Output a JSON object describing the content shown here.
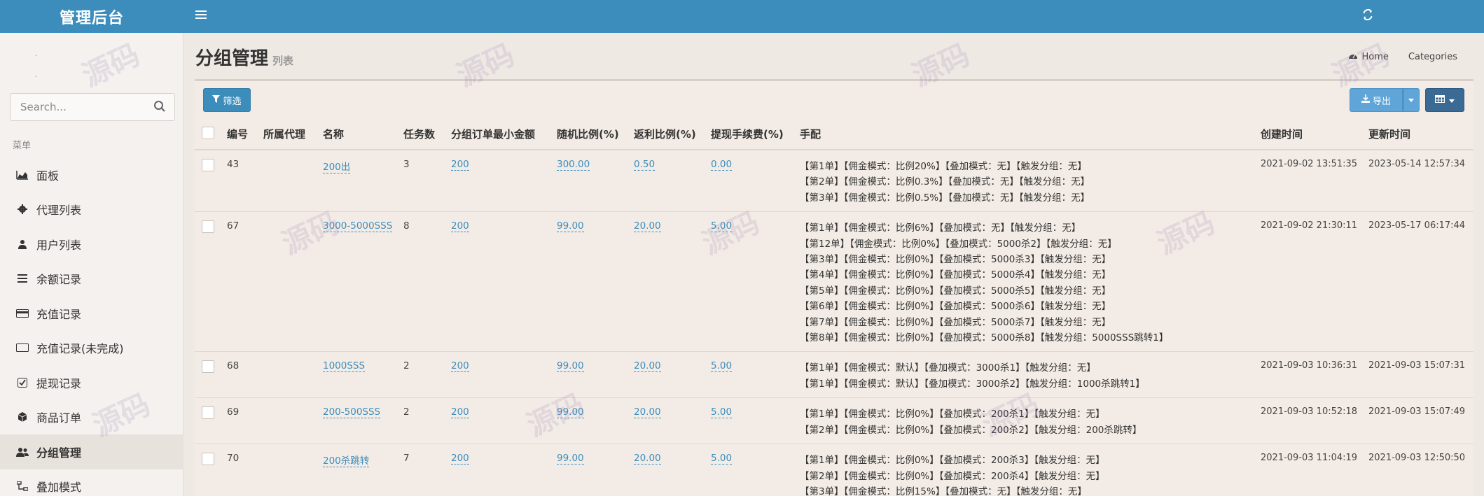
{
  "app": {
    "title": "管理后台"
  },
  "header": {
    "menu_icon": "hamburger-icon",
    "refresh_icon": "refresh-icon"
  },
  "sidebar": {
    "search_placeholder": "Search...",
    "menu_header": "菜单",
    "items": [
      {
        "label": "面板",
        "icon": "area-chart-icon"
      },
      {
        "label": "代理列表",
        "icon": "gear-icon"
      },
      {
        "label": "用户列表",
        "icon": "user-icon"
      },
      {
        "label": "余额记录",
        "icon": "list-icon"
      },
      {
        "label": "充值记录",
        "icon": "credit-card-icon"
      },
      {
        "label": "充值记录(未完成)",
        "icon": "credit-card-outline-icon"
      },
      {
        "label": "提现记录",
        "icon": "check-square-icon"
      },
      {
        "label": "商品订单",
        "icon": "cube-icon"
      },
      {
        "label": "分组管理",
        "icon": "users-icon"
      },
      {
        "label": "叠加模式",
        "icon": "sitemap-icon"
      }
    ]
  },
  "page": {
    "title": "分组管理",
    "subtitle": "列表"
  },
  "breadcrumb": {
    "home": "Home",
    "current": "Categories"
  },
  "toolbar": {
    "filter_label": "筛选",
    "export_label": "导出"
  },
  "table": {
    "headers": [
      "编号",
      "所属代理",
      "名称",
      "任务数",
      "分组订单最小金额",
      "随机比例(%)",
      "返利比例(%)",
      "提现手续费(%)",
      "手配",
      "创建时间",
      "更新时间"
    ],
    "rows": [
      {
        "id": "43",
        "agent": "",
        "name": "200出",
        "tasks": "3",
        "min_amount": "200",
        "random_ratio": "300.00",
        "rebate": "0.50",
        "fee": "0.00",
        "peipei": [
          "【第1单】【佣金模式：比例20%】【叠加模式：无】【触发分组：无】",
          "【第2单】【佣金模式：比例0.3%】【叠加模式：无】【触发分组：无】",
          "【第3单】【佣金模式：比例0.5%】【叠加模式：无】【触发分组：无】"
        ],
        "created": "2021-09-02 13:51:35",
        "updated": "2023-05-14 12:57:34"
      },
      {
        "id": "67",
        "agent": "",
        "name": "3000-5000SSS",
        "tasks": "8",
        "min_amount": "200",
        "random_ratio": "99.00",
        "rebate": "20.00",
        "fee": "5.00",
        "peipei": [
          "【第1单】【佣金模式：比例6%】【叠加模式：无】【触发分组：无】",
          "【第12单】【佣金模式：比例0%】【叠加模式：5000杀2】【触发分组：无】",
          "【第3单】【佣金模式：比例0%】【叠加模式：5000杀3】【触发分组：无】",
          "【第4单】【佣金模式：比例0%】【叠加模式：5000杀4】【触发分组：无】",
          "【第5单】【佣金模式：比例0%】【叠加模式：5000杀5】【触发分组：无】",
          "【第6单】【佣金模式：比例0%】【叠加模式：5000杀6】【触发分组：无】",
          "【第7单】【佣金模式：比例0%】【叠加模式：5000杀7】【触发分组：无】",
          "【第8单】【佣金模式：比例0%】【叠加模式：5000杀8】【触发分组：5000SSS跳转1】"
        ],
        "created": "2021-09-02 21:30:11",
        "updated": "2023-05-17 06:17:44"
      },
      {
        "id": "68",
        "agent": "",
        "name": "1000SSS",
        "tasks": "2",
        "min_amount": "200",
        "random_ratio": "99.00",
        "rebate": "20.00",
        "fee": "5.00",
        "peipei": [
          "【第1单】【佣金模式：默认】【叠加模式：3000杀1】【触发分组：无】",
          "【第1单】【佣金模式：默认】【叠加模式：3000杀2】【触发分组：1000杀跳转1】"
        ],
        "created": "2021-09-03 10:36:31",
        "updated": "2021-09-03 15:07:31"
      },
      {
        "id": "69",
        "agent": "",
        "name": "200-500SSS",
        "tasks": "2",
        "min_amount": "200",
        "random_ratio": "99.00",
        "rebate": "20.00",
        "fee": "5.00",
        "peipei": [
          "【第1单】【佣金模式：比例0%】【叠加模式：200杀1】【触发分组：无】",
          "【第2单】【佣金模式：比例0%】【叠加模式：200杀2】【触发分组：200杀跳转】"
        ],
        "created": "2021-09-03 10:52:18",
        "updated": "2021-09-03 15:07:49"
      },
      {
        "id": "70",
        "agent": "",
        "name": "200杀跳转",
        "tasks": "7",
        "min_amount": "200",
        "random_ratio": "99.00",
        "rebate": "20.00",
        "fee": "5.00",
        "peipei": [
          "【第1单】【佣金模式：比例0%】【叠加模式：200杀3】【触发分组：无】",
          "【第2单】【佣金模式：比例0%】【叠加模式：200杀4】【触发分组：无】",
          "【第3单】【佣金模式：比例15%】【叠加模式：无】【触发分组：无】"
        ],
        "created": "2021-09-03 11:04:19",
        "updated": "2021-09-03 12:50:50"
      }
    ]
  }
}
